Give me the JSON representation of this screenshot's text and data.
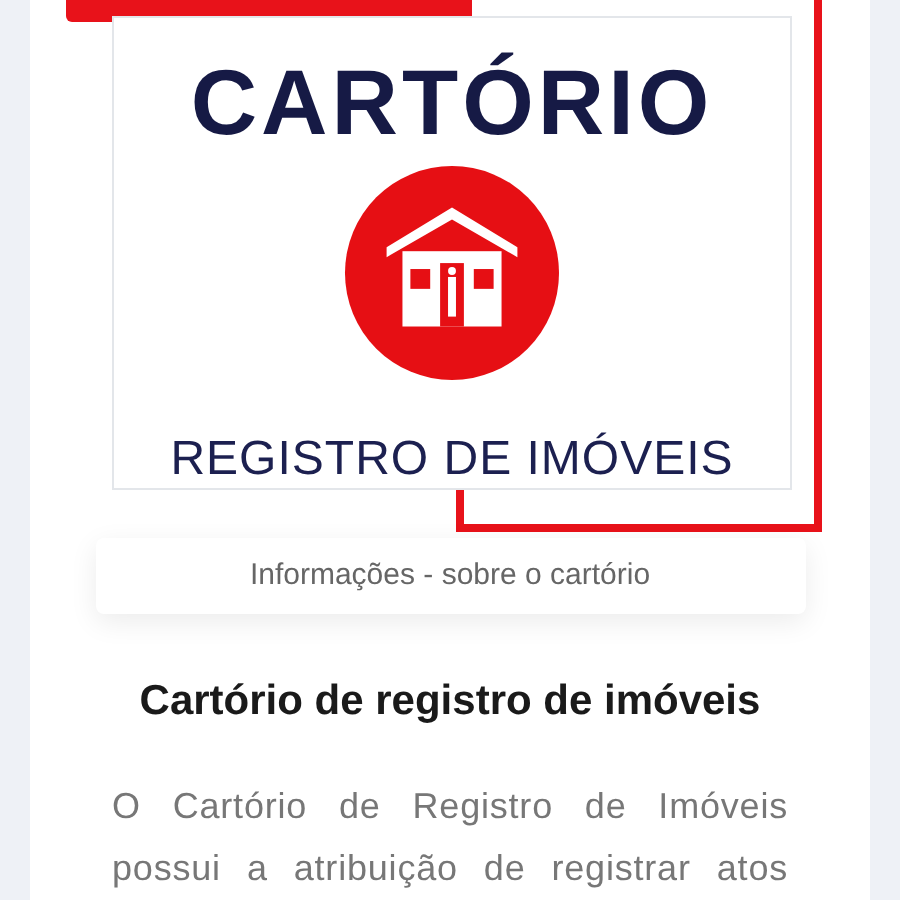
{
  "logo": {
    "title": "CARTÓRIO",
    "subtitle": "REGISTRO DE IMÓVEIS"
  },
  "info_tab": {
    "label": "Informações - sobre o cartório"
  },
  "heading": "Cartório de registro de imóveis",
  "paragraph": "O Cartório de Registro de Imóveis possui a atribuição de registrar atos"
}
